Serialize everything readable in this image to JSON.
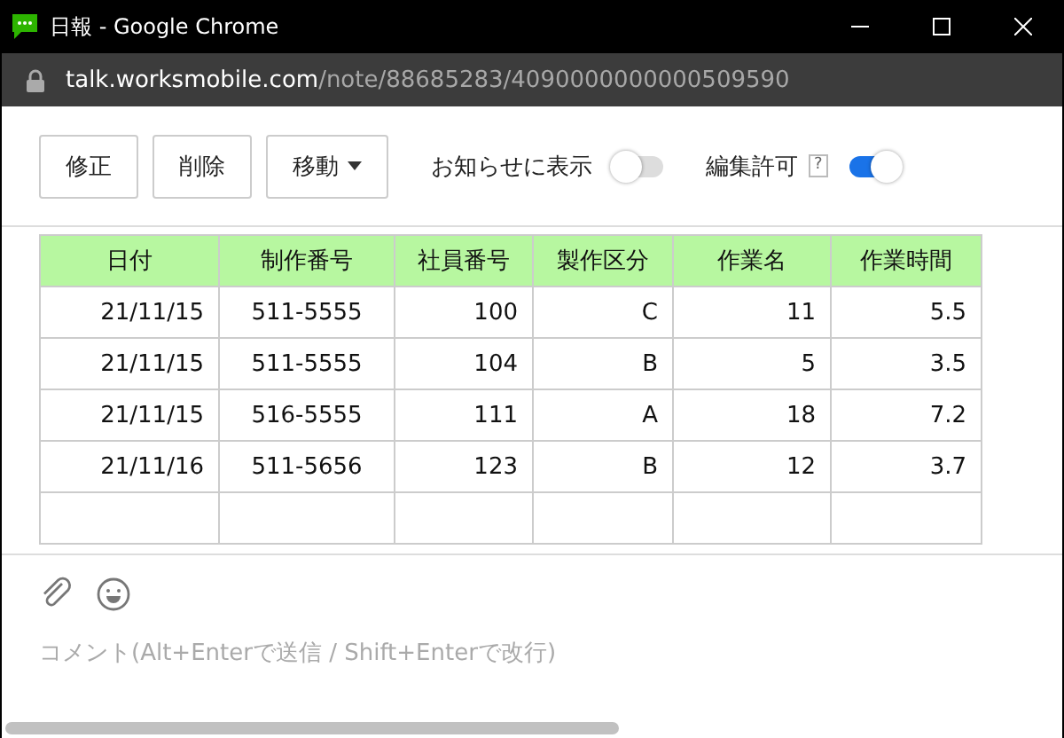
{
  "window": {
    "title": "日報 - Google Chrome"
  },
  "address": {
    "host": "talk.worksmobile.com",
    "path": "/note/88685283/4090000000000509590"
  },
  "toolbar": {
    "buttons": [
      {
        "label": "修正",
        "kind": "plain"
      },
      {
        "label": "削除",
        "kind": "plain"
      },
      {
        "label": "移動",
        "kind": "dropdown"
      }
    ],
    "toggles": [
      {
        "label": "お知らせに表示",
        "on": false
      },
      {
        "label": "編集許可",
        "on": true,
        "help": "?"
      }
    ]
  },
  "table": {
    "columns": [
      "日付",
      "制作番号",
      "社員番号",
      "製作区分",
      "作業名",
      "作業時間"
    ],
    "rows": [
      [
        "21/11/15",
        "511-5555",
        "100",
        "C",
        "11",
        "5.5"
      ],
      [
        "21/11/15",
        "511-5555",
        "104",
        "B",
        "5",
        "3.5"
      ],
      [
        "21/11/15",
        "516-5555",
        "111",
        "A",
        "18",
        "7.2"
      ],
      [
        "21/11/16",
        "511-5656",
        "123",
        "B",
        "12",
        "3.7"
      ]
    ]
  },
  "comment": {
    "placeholder": "コメント(Alt+Enterで送信 / Shift+Enterで改行)"
  }
}
